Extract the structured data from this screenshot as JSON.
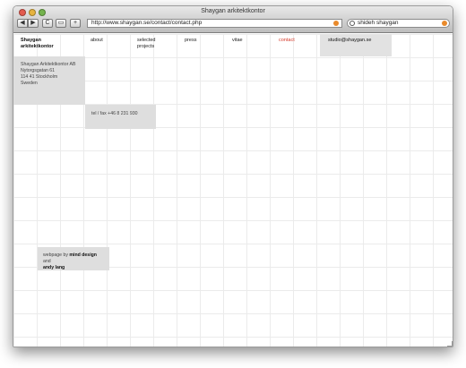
{
  "window": {
    "title": "Shaygan arkitektkontor"
  },
  "toolbar": {
    "back_label": "◀",
    "forward_label": "▶",
    "reload_label": "C",
    "bookmark_label": "▭",
    "add_label": "+",
    "url": "http://www.shaygan.se/contact/contact.php",
    "search_value": "shideh shaygan"
  },
  "site": {
    "brand_line1": "Shaygan",
    "brand_line2": "arkitektkontor",
    "nav": {
      "about": "about",
      "projects_line1": "selected",
      "projects_line2": "projects",
      "press": "press",
      "vitae": "vitae",
      "contact": "contact",
      "email": "studio@shaygan.se"
    },
    "address": {
      "line1": "Shaygan Arkitektkontor AB",
      "line2": "Nytorgsgatan 61",
      "line3": "114 41 Stockholm",
      "line4": "Sweden"
    },
    "tel": "tel / fax +46 8 231 930",
    "credit": {
      "prefix": "webpage by ",
      "author1": "mind design",
      "joiner": " and",
      "author2": "andy lang"
    }
  },
  "colors": {
    "accent": "#d63a2a",
    "panel": "#dedede",
    "grid": "#ebebeb"
  }
}
